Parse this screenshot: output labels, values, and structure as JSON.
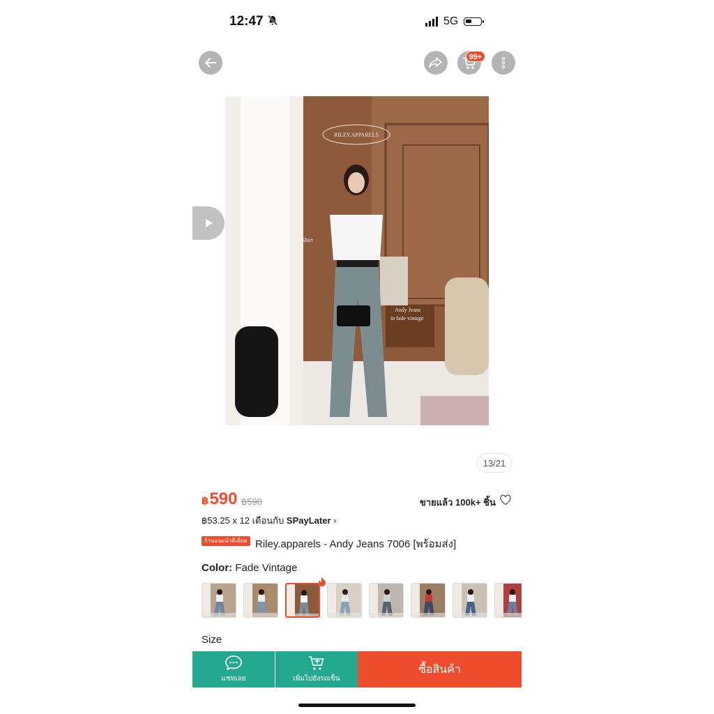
{
  "status_bar": {
    "time": "12:47",
    "network": "5G"
  },
  "nav": {
    "cart_badge": "99+"
  },
  "image": {
    "watermark": "RILEY.APPARELS",
    "note_shirt": "Shirt",
    "note_jeans_1": "Andy Jeans",
    "note_jeans_2": "in fade vintage",
    "counter": "13/21"
  },
  "product": {
    "currency": "฿",
    "price": "590",
    "original_price": "฿590",
    "sold": "ขายแล้ว 100k+ ชิ้น",
    "installment_prefix": "฿53.25 x 12 เดือนกับ ",
    "installment_brand": "SPayLater",
    "installment_chevron": "›",
    "tag": "ร้านแนะนำดีเยี่ยม",
    "title": "Riley.apparels - Andy Jeans 7006 [พร้อมส่ง]",
    "color_key": "Color:",
    "color_value": " Fade Vintage",
    "size_label": "Size"
  },
  "variants": [
    {
      "bg": "#b8a48e",
      "fig": "#6f86a0",
      "top": "#f0f0f0"
    },
    {
      "bg": "#a88a6c",
      "fig": "#7e95ad",
      "top": "#ececec"
    },
    {
      "bg": "#8a5a3b",
      "fig": "#7a8e92",
      "top": "#f5f5f5"
    },
    {
      "bg": "#d8d0c4",
      "fig": "#8aa0b8",
      "top": "#e8e8e8"
    },
    {
      "bg": "#bdb7b0",
      "fig": "#5a6470",
      "top": "#d0d0d0"
    },
    {
      "bg": "#9a7d62",
      "fig": "#3a4a6a",
      "top": "#c23a3a"
    },
    {
      "bg": "#c9c1b4",
      "fig": "#4a6288",
      "top": "#f0f0f0"
    },
    {
      "bg": "#b04040",
      "fig": "#6a7f99",
      "top": "#f0f0f0"
    }
  ],
  "bottom_bar": {
    "chat_label": "แชทเลย",
    "add_cart_label": "เพิ่มไปยังรถเข็น",
    "buy_label": "ซื้อสินค้า"
  },
  "colors": {
    "accent": "#ee4d2d",
    "secondary": "#25a98e"
  }
}
